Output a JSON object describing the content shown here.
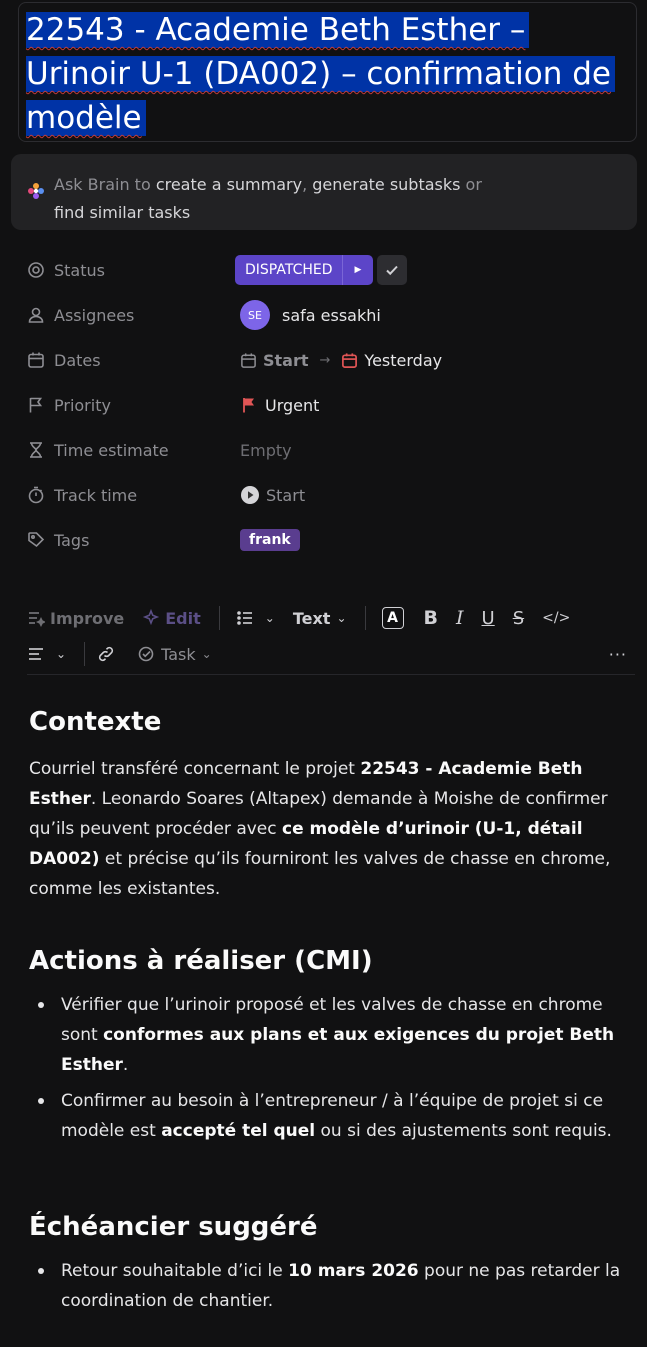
{
  "title": "22543 - Academie Beth Esther – Urinoir U-1 (DA002) – confirmation de modèle",
  "brain": {
    "prefix": "Ask Brain to ",
    "action1": "create a summary",
    "sep": ", ",
    "action2": "generate subtasks",
    "or": " or",
    "action3": "find similar tasks"
  },
  "properties": {
    "status": {
      "label": "Status",
      "value": "DISPATCHED"
    },
    "assignees": {
      "label": "Assignees",
      "initials": "SE",
      "name": "safa essakhi"
    },
    "dates": {
      "label": "Dates",
      "start": "Start",
      "due": "Yesterday"
    },
    "priority": {
      "label": "Priority",
      "value": "Urgent"
    },
    "time_estimate": {
      "label": "Time estimate",
      "value": "Empty"
    },
    "track_time": {
      "label": "Track time",
      "value": "Start"
    },
    "tags": {
      "label": "Tags",
      "value": "frank"
    }
  },
  "toolbar": {
    "improve": "Improve",
    "edit": "Edit",
    "text": "Text",
    "task": "Task",
    "more": "···"
  },
  "document": {
    "h1": "Contexte",
    "p1_a": "Courriel transféré concernant le projet ",
    "p1_b": "22543 - Academie Beth Esther",
    "p1_c": ". Leonardo Soares (Altapex) demande à Moishe de confirmer qu’ils peuvent procéder avec ",
    "p1_d": "ce modèle d’urinoir (U-1, détail DA002)",
    "p1_e": " et précise qu’ils fourniront les valves de chasse en chrome, comme les existantes.",
    "h2": "Actions à réaliser (CMI)",
    "li1_a": "Vérifier que l’urinoir proposé et les valves de chasse en chrome sont ",
    "li1_b": "conformes aux plans et aux exigences du projet Beth Esther",
    "li1_c": ".",
    "li2_a": "Confirmer au besoin à l’entrepreneur / à l’équipe de projet si ce modèle est ",
    "li2_b": "accepté tel quel",
    "li2_c": " ou si des ajustements sont requis.",
    "h3": "Échéancier suggéré",
    "li3_a": "Retour souhaitable d’ici le ",
    "li3_b": "10 mars 2026",
    "li3_c": " pour ne pas retarder la coordination de chantier."
  },
  "colors": {
    "background": "#111112",
    "status": "#5c45c8",
    "tag": "#5a3d8f",
    "priority_flag": "#e05555",
    "selection": "#0033a6"
  }
}
